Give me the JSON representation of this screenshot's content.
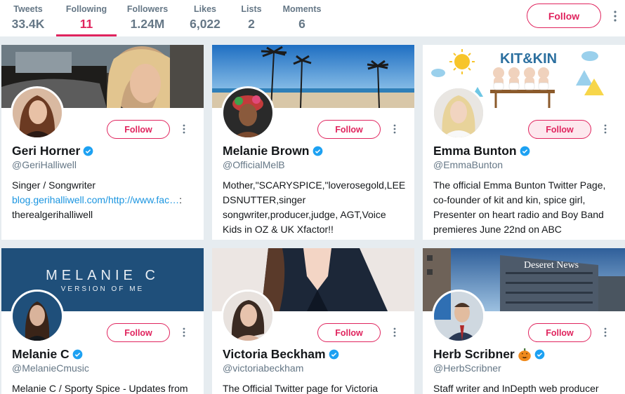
{
  "profile_nav": {
    "stats": [
      {
        "label": "Tweets",
        "value": "33.4K"
      },
      {
        "label": "Following",
        "value": "11"
      },
      {
        "label": "Followers",
        "value": "1.24M"
      },
      {
        "label": "Likes",
        "value": "6,022"
      },
      {
        "label": "Lists",
        "value": "2"
      },
      {
        "label": "Moments",
        "value": "6"
      }
    ],
    "active_tab": "Following",
    "follow_label": "Follow"
  },
  "cards": [
    {
      "name": "Geri Horner",
      "handle": "@GeriHalliwell",
      "follow_label": "Follow",
      "bio_lines": [
        "Singer / Songwriter"
      ],
      "bio_link": "blog.gerihalliwell.com/http://www.fac…",
      "bio_after_link": ":",
      "bio_tail": "therealgerihalliwell",
      "verified": true
    },
    {
      "name": "Melanie Brown",
      "handle": "@OfficialMelB",
      "follow_label": "Follow",
      "bio": "Mother,\"SCARYSPICE,\"loverosegold,LEEDSNUTTER,singer songwriter,producer,judge, AGT,Voice Kids in OZ & UK Xfactor!!",
      "verified": true
    },
    {
      "name": "Emma Bunton",
      "handle": "@EmmaBunton",
      "follow_label": "Follow",
      "bio": "The official Emma Bunton Twitter Page, co-founder of kit and kin, spice girl, Presenter on heart radio and Boy Band premieres June 22nd on ABC",
      "banner_text": "KIT&KIN",
      "verified": true
    },
    {
      "name": "Melanie C",
      "handle": "@MelanieCmusic",
      "follow_label": "Follow",
      "bio": "Melanie C / Sporty Spice - Updates from",
      "banner_title": "MELANIE C",
      "banner_subtitle": "VERSION OF ME",
      "verified": true
    },
    {
      "name": "Victoria Beckham",
      "handle": "@victoriabeckham",
      "follow_label": "Follow",
      "bio": "The Official Twitter page for Victoria",
      "verified": true
    },
    {
      "name": "Herb Scribner",
      "handle": "@HerbScribner",
      "follow_label": "Follow",
      "bio": "Staff writer and InDepth web producer",
      "banner_sign": "Deseret News",
      "verified": true
    }
  ],
  "colors": {
    "accent": "#e0245e",
    "link": "#1b95e0",
    "muted": "#657786",
    "verified": "#1da1f2",
    "background": "#e6ecf0"
  }
}
